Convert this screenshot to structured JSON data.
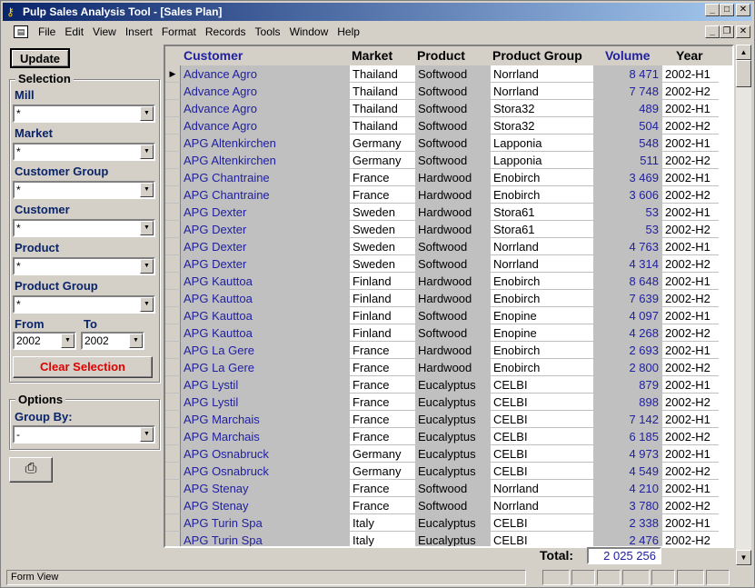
{
  "window": {
    "title": "Pulp Sales Analysis Tool - [Sales Plan]",
    "minimize": "_",
    "maximize": "□",
    "close": "✕",
    "mdi_minimize": "_",
    "mdi_restore": "❐",
    "mdi_close": "✕"
  },
  "menu": [
    "File",
    "Edit",
    "View",
    "Insert",
    "Format",
    "Records",
    "Tools",
    "Window",
    "Help"
  ],
  "left": {
    "update_label": "Update",
    "selection_title": "Selection",
    "mill_label": "Mill",
    "mill_value": "*",
    "market_label": "Market",
    "market_value": "*",
    "customer_group_label": "Customer Group",
    "customer_group_value": "*",
    "customer_label": "Customer",
    "customer_value": "*",
    "product_label": "Product",
    "product_value": "*",
    "product_group_label": "Product Group",
    "product_group_value": "*",
    "from_label": "From",
    "to_label": "To",
    "from_value": "2002",
    "to_value": "2002",
    "clear_label": "Clear Selection",
    "options_title": "Options",
    "group_by_label": "Group By:",
    "group_by_value": "-",
    "print_icon": "printer-icon"
  },
  "grid": {
    "headers": [
      "Customer",
      "Market",
      "Product",
      "Product Group",
      "Volume",
      "Year"
    ],
    "rows": [
      [
        "Advance Agro",
        "Thailand",
        "Softwood",
        "Norrland",
        "8 471",
        "2002-H1"
      ],
      [
        "Advance Agro",
        "Thailand",
        "Softwood",
        "Norrland",
        "7 748",
        "2002-H2"
      ],
      [
        "Advance Agro",
        "Thailand",
        "Softwood",
        "Stora32",
        "489",
        "2002-H1"
      ],
      [
        "Advance Agro",
        "Thailand",
        "Softwood",
        "Stora32",
        "504",
        "2002-H2"
      ],
      [
        "APG Altenkirchen",
        "Germany",
        "Softwood",
        "Lapponia",
        "548",
        "2002-H1"
      ],
      [
        "APG Altenkirchen",
        "Germany",
        "Softwood",
        "Lapponia",
        "511",
        "2002-H2"
      ],
      [
        "APG Chantraine",
        "France",
        "Hardwood",
        "Enobirch",
        "3 469",
        "2002-H1"
      ],
      [
        "APG Chantraine",
        "France",
        "Hardwood",
        "Enobirch",
        "3 606",
        "2002-H2"
      ],
      [
        "APG Dexter",
        "Sweden",
        "Hardwood",
        "Stora61",
        "53",
        "2002-H1"
      ],
      [
        "APG Dexter",
        "Sweden",
        "Hardwood",
        "Stora61",
        "53",
        "2002-H2"
      ],
      [
        "APG Dexter",
        "Sweden",
        "Softwood",
        "Norrland",
        "4 763",
        "2002-H1"
      ],
      [
        "APG Dexter",
        "Sweden",
        "Softwood",
        "Norrland",
        "4 314",
        "2002-H2"
      ],
      [
        "APG Kauttoa",
        "Finland",
        "Hardwood",
        "Enobirch",
        "8 648",
        "2002-H1"
      ],
      [
        "APG Kauttoa",
        "Finland",
        "Hardwood",
        "Enobirch",
        "7 639",
        "2002-H2"
      ],
      [
        "APG Kauttoa",
        "Finland",
        "Softwood",
        "Enopine",
        "4 097",
        "2002-H1"
      ],
      [
        "APG Kauttoa",
        "Finland",
        "Softwood",
        "Enopine",
        "4 268",
        "2002-H2"
      ],
      [
        "APG La Gere",
        "France",
        "Hardwood",
        "Enobirch",
        "2 693",
        "2002-H1"
      ],
      [
        "APG La Gere",
        "France",
        "Hardwood",
        "Enobirch",
        "2 800",
        "2002-H2"
      ],
      [
        "APG Lystil",
        "France",
        "Eucalyptus",
        "CELBI",
        "879",
        "2002-H1"
      ],
      [
        "APG Lystil",
        "France",
        "Eucalyptus",
        "CELBI",
        "898",
        "2002-H2"
      ],
      [
        "APG Marchais",
        "France",
        "Eucalyptus",
        "CELBI",
        "7 142",
        "2002-H1"
      ],
      [
        "APG Marchais",
        "France",
        "Eucalyptus",
        "CELBI",
        "6 185",
        "2002-H2"
      ],
      [
        "APG Osnabruck",
        "Germany",
        "Eucalyptus",
        "CELBI",
        "4 973",
        "2002-H1"
      ],
      [
        "APG Osnabruck",
        "Germany",
        "Eucalyptus",
        "CELBI",
        "4 549",
        "2002-H2"
      ],
      [
        "APG Stenay",
        "France",
        "Softwood",
        "Norrland",
        "4 210",
        "2002-H1"
      ],
      [
        "APG Stenay",
        "France",
        "Softwood",
        "Norrland",
        "3 780",
        "2002-H2"
      ],
      [
        "APG Turin Spa",
        "Italy",
        "Eucalyptus",
        "CELBI",
        "2 338",
        "2002-H1"
      ],
      [
        "APG Turin Spa",
        "Italy",
        "Eucalyptus",
        "CELBI",
        "2 476",
        "2002-H2"
      ]
    ],
    "current_row_marker": "▶",
    "total_label": "Total:",
    "total_value": "2 025 256"
  },
  "status": {
    "mode": "Form View"
  },
  "colors": {
    "title_start": "#0a246a",
    "title_end": "#a6caf0",
    "link_blue": "#2020a0",
    "clear_red": "#e00000"
  }
}
